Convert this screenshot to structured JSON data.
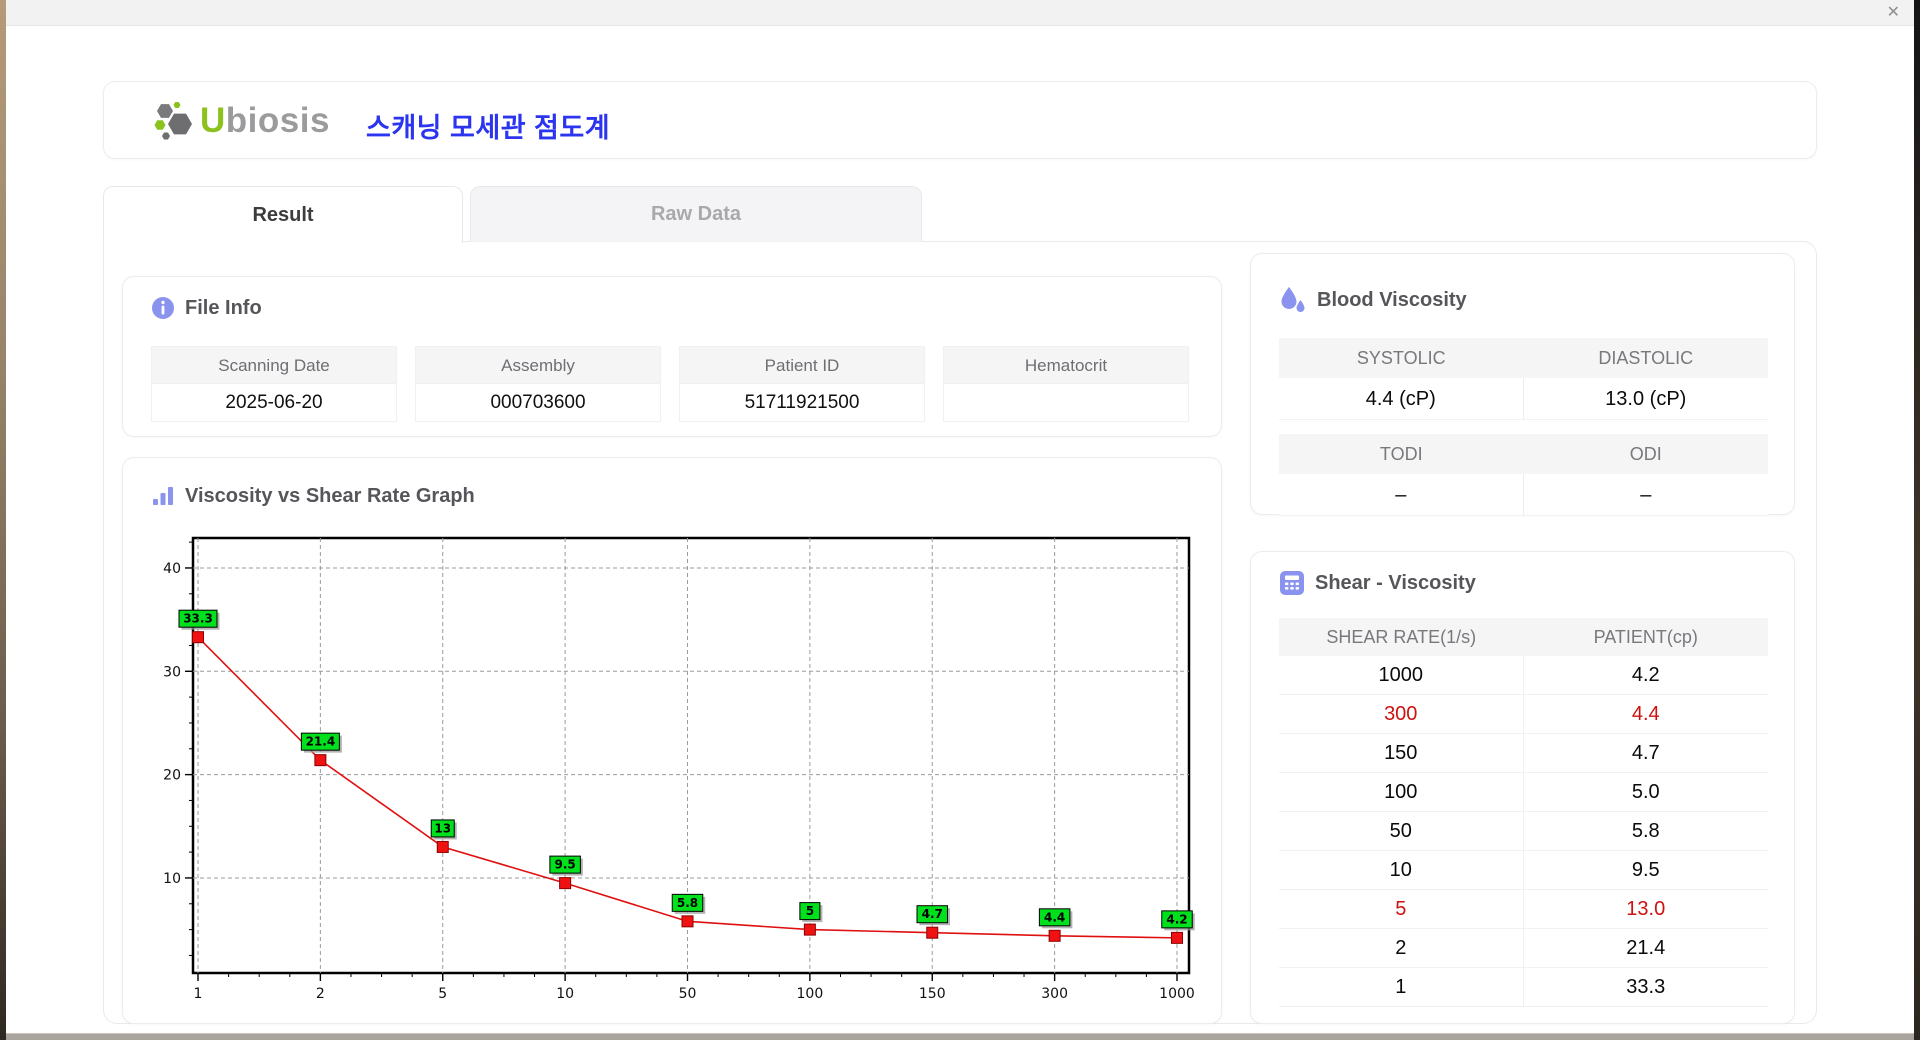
{
  "window": {
    "close_icon": "✕"
  },
  "header": {
    "logo_u": "U",
    "logo_rest": "biosis",
    "app_title": "스캐닝 모세관 점도계"
  },
  "tabs": {
    "result": "Result",
    "raw_data": "Raw Data"
  },
  "file_info": {
    "title": "File Info",
    "fields": [
      {
        "label": "Scanning Date",
        "value": "2025-06-20"
      },
      {
        "label": "Assembly",
        "value": "000703600"
      },
      {
        "label": "Patient ID",
        "value": "51711921500"
      },
      {
        "label": "Hematocrit",
        "value": ""
      }
    ]
  },
  "graph": {
    "title": "Viscosity vs Shear Rate Graph"
  },
  "blood_viscosity": {
    "title": "Blood Viscosity",
    "groups": [
      {
        "labels": [
          "SYSTOLIC",
          "DIASTOLIC"
        ],
        "values": [
          "4.4 (cP)",
          "13.0 (cP)"
        ]
      },
      {
        "labels": [
          "TODI",
          "ODI"
        ],
        "values": [
          "–",
          "–"
        ]
      }
    ]
  },
  "shear_table": {
    "title": "Shear - Viscosity",
    "columns": [
      "SHEAR RATE(1/s)",
      "PATIENT(cp)"
    ],
    "rows": [
      [
        "1000",
        "4.2"
      ],
      [
        "300",
        "4.4"
      ],
      [
        "150",
        "4.7"
      ],
      [
        "100",
        "5.0"
      ],
      [
        "50",
        "5.8"
      ],
      [
        "10",
        "9.5"
      ],
      [
        "5",
        "13.0"
      ],
      [
        "2",
        "21.4"
      ],
      [
        "1",
        "33.3"
      ]
    ],
    "highlight_row_indices": [
      1,
      6
    ],
    "highlight_color": "#ce1111"
  },
  "chart_data": {
    "type": "line",
    "title": "Viscosity vs Shear Rate Graph",
    "x_categories": [
      "1",
      "2",
      "5",
      "10",
      "50",
      "100",
      "150",
      "300",
      "1000"
    ],
    "series": [
      {
        "name": "PATIENT(cp)",
        "values": [
          33.3,
          21.4,
          13,
          9.5,
          5.8,
          5,
          4.7,
          4.4,
          4.2
        ]
      }
    ],
    "point_labels": [
      "33.3",
      "21.4",
      "13",
      "9.5",
      "5.8",
      "5",
      "4.7",
      "4.4",
      "4.2"
    ],
    "yticks": [
      10,
      20,
      30,
      40
    ],
    "ylim": [
      0.8,
      42.9
    ],
    "xlabel": "",
    "ylabel": "",
    "grid": true,
    "legend": false,
    "line_color": "#e01010",
    "marker_color": "#f01212",
    "marker_border": "#8d0000",
    "point_label_bg": "#00e01c",
    "grid_color": "#9b9b9b"
  },
  "colors": {
    "accent_icon": "#8a93ee",
    "title_blue": "#2b34ef",
    "logo_green": "#8cc21e",
    "logo_gray": "#9b9b9d",
    "highlight_red": "#ce1111",
    "header_row_bg": "#f5f5f6"
  }
}
